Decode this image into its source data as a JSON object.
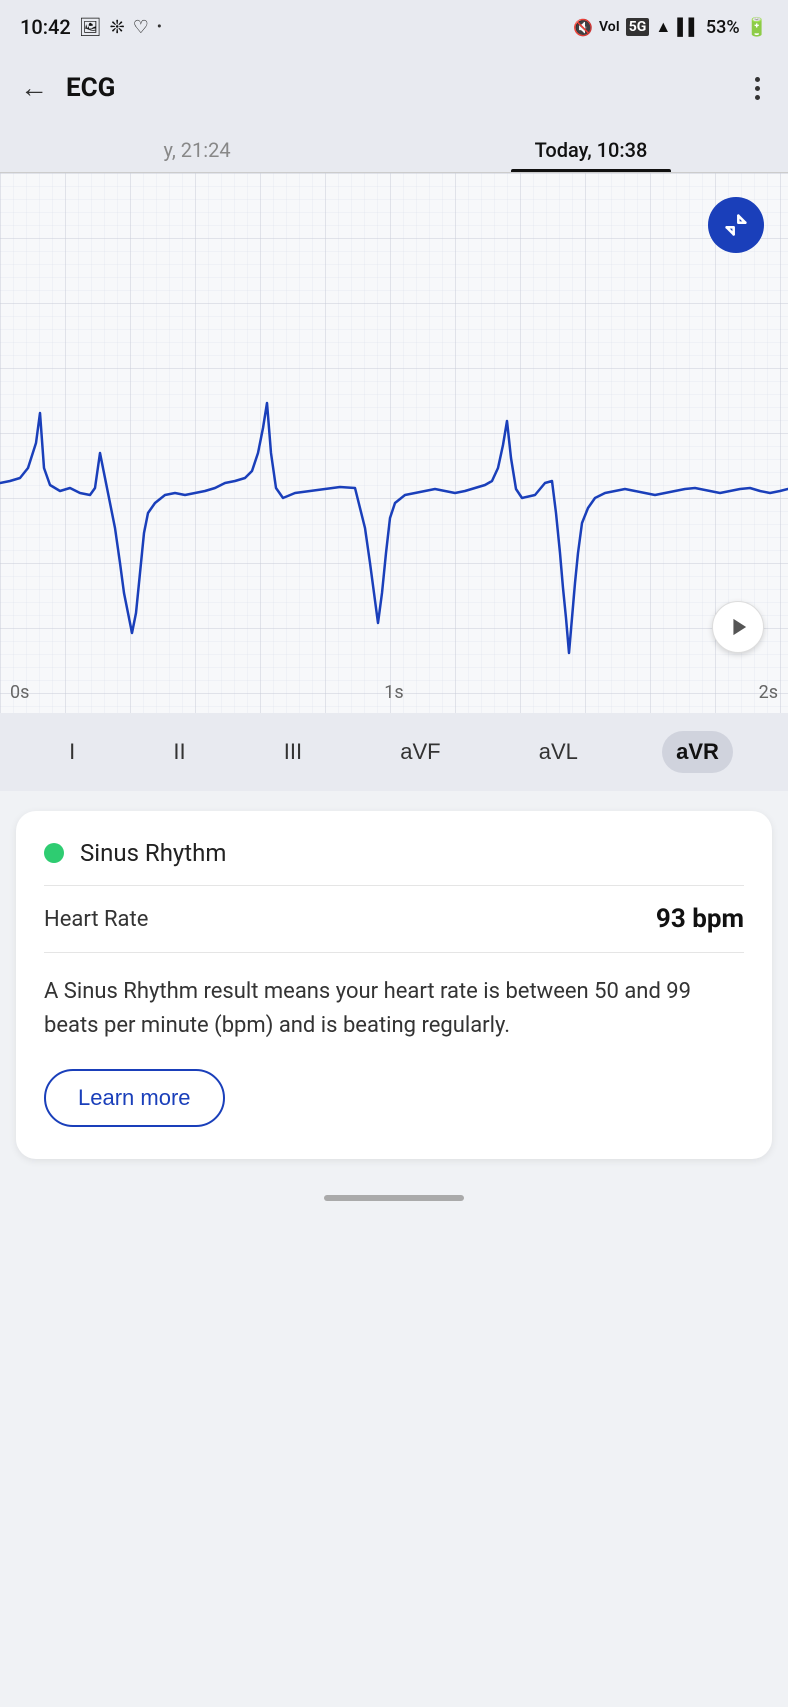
{
  "statusBar": {
    "time": "10:42",
    "batteryPercent": "53%",
    "icons": [
      "photo",
      "bluetooth",
      "heart",
      "dot"
    ]
  },
  "appBar": {
    "title": "ECG",
    "backLabel": "←",
    "moreLabel": "⋮"
  },
  "dateTabs": [
    {
      "label": "y, 21:24",
      "active": false
    },
    {
      "label": "Today, 10:38",
      "active": true
    }
  ],
  "ecgChart": {
    "timeLabels": [
      "0s",
      "1s",
      "2s"
    ],
    "expandIconLabel": "expand-icon",
    "playIconLabel": "play-icon"
  },
  "leadSelector": {
    "leads": [
      {
        "label": "I",
        "active": false
      },
      {
        "label": "II",
        "active": false
      },
      {
        "label": "III",
        "active": false
      },
      {
        "label": "aVF",
        "active": false
      },
      {
        "label": "aVL",
        "active": false
      },
      {
        "label": "aVR",
        "active": true
      }
    ]
  },
  "resultCard": {
    "rhythmDotColor": "#2ecc71",
    "rhythmLabel": "Sinus Rhythm",
    "heartRateLabel": "Heart Rate",
    "heartRateValue": "93 bpm",
    "description": "A Sinus Rhythm result means your heart rate is between 50 and 99 beats per minute (bpm) and is beating regularly.",
    "learnMoreLabel": "Learn more"
  },
  "bottomBar": {
    "handleVisible": true
  }
}
